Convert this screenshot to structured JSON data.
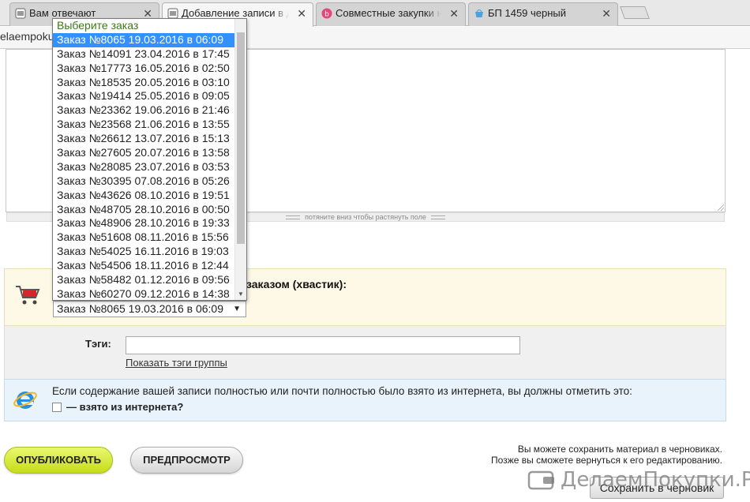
{
  "browser": {
    "tabs": [
      {
        "label": "Вам отвечают",
        "favicon": "page-icon",
        "active": false
      },
      {
        "label": "Добавление записи в дн",
        "favicon": "page-icon",
        "active": true
      },
      {
        "label": "Совместные закупки на",
        "favicon": "b-brand-icon",
        "active": false
      },
      {
        "label": "БП 1459 черный",
        "favicon": "basket-icon",
        "active": false
      }
    ],
    "close_glyph": "✕",
    "url": "elaempoku"
  },
  "editor": {
    "resize_hint": "потяните вниз чтобы растянуть поле"
  },
  "order_select": {
    "title_suffix": "заказом (хвастик):",
    "selected_value": "Заказ №8065 19.03.2016 в 06:09",
    "options": [
      "Выберите заказ",
      "Заказ №8065 19.03.2016 в 06:09",
      "Заказ №14091 23.04.2016 в 17:45",
      "Заказ №17773 16.05.2016 в 02:50",
      "Заказ №18535 20.05.2016 в 03:10",
      "Заказ №19414 25.05.2016 в 09:05",
      "Заказ №23362 19.06.2016 в 21:46",
      "Заказ №23568 21.06.2016 в 13:55",
      "Заказ №26612 13.07.2016 в 15:13",
      "Заказ №27605 20.07.2016 в 13:58",
      "Заказ №28085 23.07.2016 в 03:53",
      "Заказ №30395 07.08.2016 в 05:26",
      "Заказ №43626 08.10.2016 в 19:51",
      "Заказ №48705 28.10.2016 в 00:50",
      "Заказ №48906 28.10.2016 в 19:33",
      "Заказ №51608 08.11.2016 в 15:56",
      "Заказ №54025 16.11.2016 в 19:03",
      "Заказ №54506 18.11.2016 в 12:44",
      "Заказ №58482 01.12.2016 в 09:56",
      "Заказ №60270 09.12.2016 в 14:38"
    ]
  },
  "tags": {
    "label": "Тэги:",
    "input_value": "",
    "show_group_tags_link": "Показать тэги группы"
  },
  "internet": {
    "notice": "Если содержание вашей записи полностью или почти полностью было взято из интернета, вы должны отметить это:",
    "checkbox_label": "— взято из интернета?",
    "checked": false
  },
  "actions": {
    "publish": "ОПУБЛИКОВАТЬ",
    "preview": "ПРЕДПРОСМОТР",
    "draft_note_line1": "Вы можете сохранить материал в черновиках.",
    "draft_note_line2": "Позже вы сможете вернуться к его редактированию.",
    "save_draft": "Сохранить в черновик"
  },
  "watermark": {
    "text": "ДелаемПокупки.Ру"
  },
  "colors": {
    "publish_green": "#c6dc18",
    "selected_option_blue": "#3390ff",
    "tail_panel_bg": "#fdf9e6",
    "internet_panel_bg": "#e9f3fb"
  }
}
